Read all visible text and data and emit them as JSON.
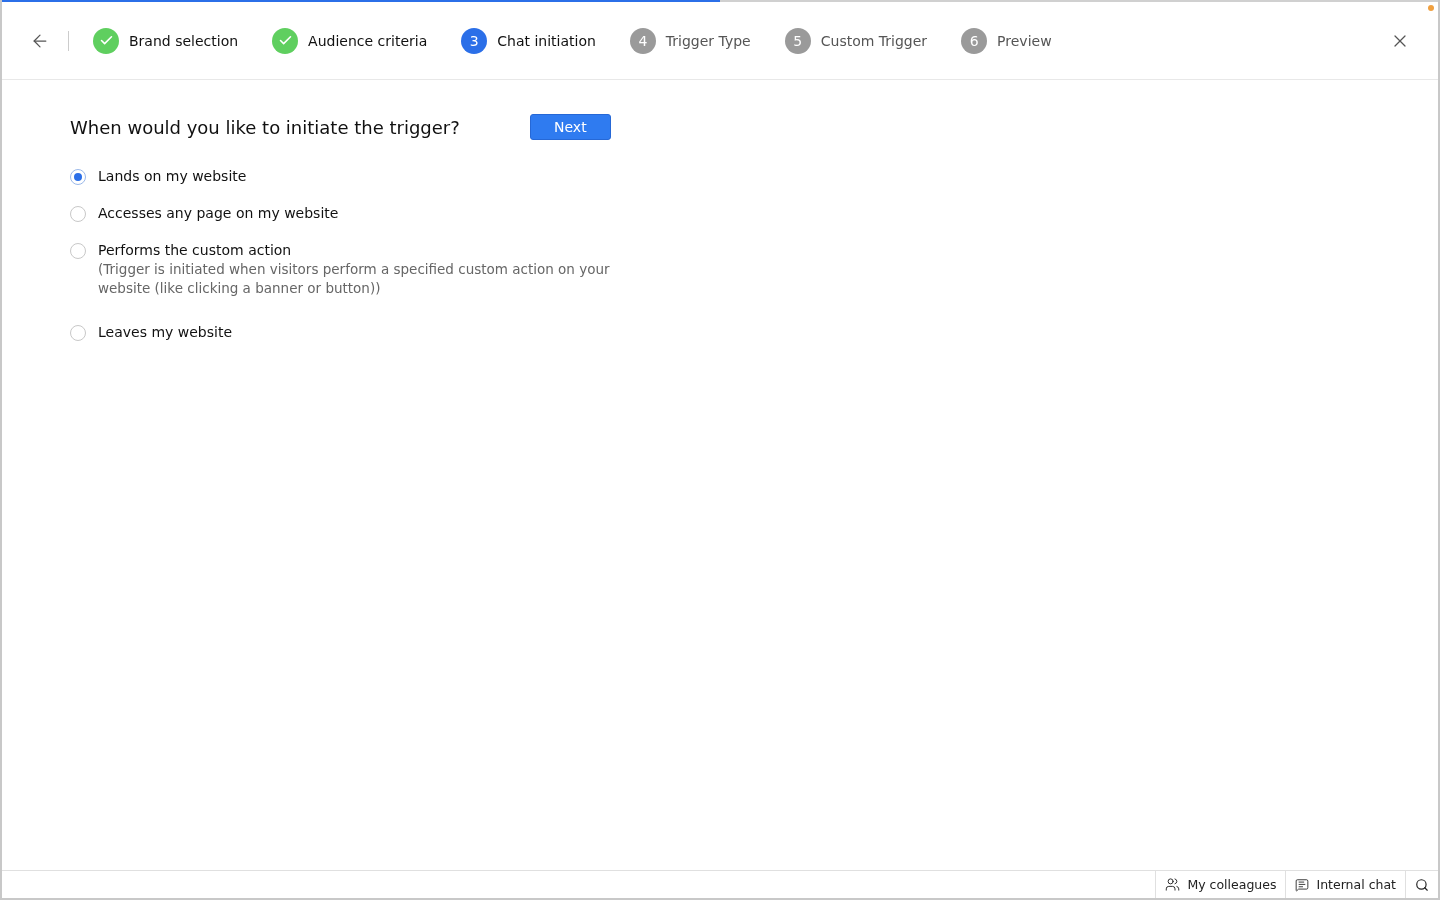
{
  "progress": {
    "level": 0.5
  },
  "steps": [
    {
      "label": "Brand selection",
      "done": true,
      "selected": false
    },
    {
      "label": "Audience criteria",
      "done": true,
      "selected": false
    },
    {
      "number": "3",
      "label": "Chat initiation",
      "done": false,
      "selected": true
    },
    {
      "number": "4",
      "label": "Trigger Type",
      "done": false,
      "selected": false
    },
    {
      "number": "5",
      "label": "Custom Trigger",
      "done": false,
      "selected": false
    },
    {
      "number": "6",
      "label": "Preview",
      "done": false,
      "selected": false
    }
  ],
  "question": "When would you like to initiate the trigger?",
  "next_button": "Next",
  "options": [
    {
      "label": "Lands on my website",
      "selected": true
    },
    {
      "label": "Accesses any page on my website",
      "selected": false
    },
    {
      "label": "Performs the custom action",
      "description": "(Trigger is initiated when visitors perform a specified custom action on your website (like clicking a banner or button))",
      "selected": false
    },
    {
      "label": "Leaves my website",
      "selected": false
    }
  ],
  "footer": [
    {
      "kind": "colleagues",
      "label": "My colleagues"
    },
    {
      "kind": "chat",
      "label": "Internal chat"
    },
    {
      "kind": "search"
    }
  ]
}
